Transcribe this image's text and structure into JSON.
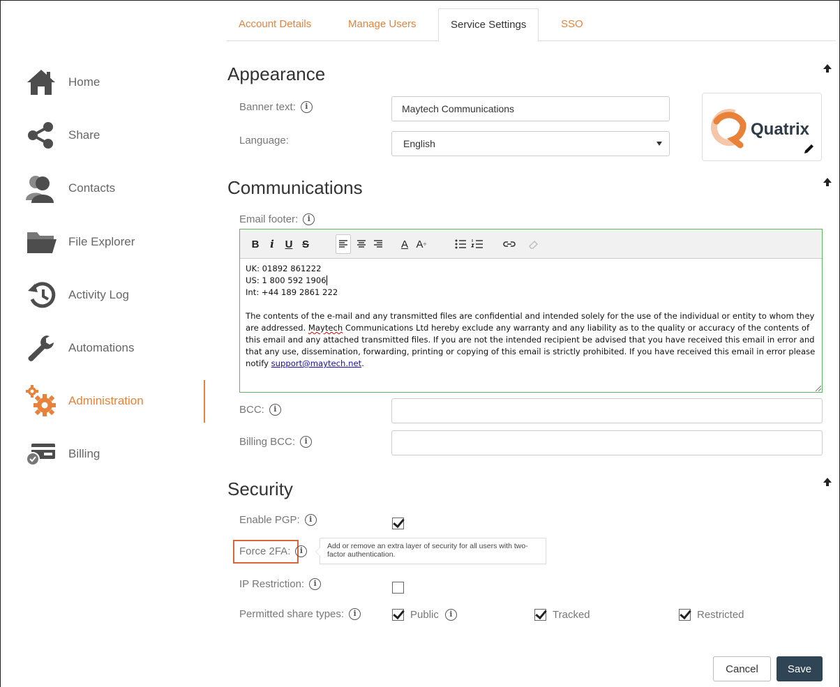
{
  "tabs": [
    {
      "label": "Account Details"
    },
    {
      "label": "Manage Users"
    },
    {
      "label": "Service Settings",
      "active": true
    },
    {
      "label": "SSO"
    }
  ],
  "sidebar": {
    "items": [
      {
        "label": "Home",
        "icon": "home-icon"
      },
      {
        "label": "Share",
        "icon": "share-icon"
      },
      {
        "label": "Contacts",
        "icon": "contacts-icon"
      },
      {
        "label": "File Explorer",
        "icon": "folder-icon"
      },
      {
        "label": "Activity Log",
        "icon": "history-icon"
      },
      {
        "label": "Automations",
        "icon": "wrench-icon"
      },
      {
        "label": "Administration",
        "icon": "gears-icon",
        "active": true
      },
      {
        "label": "Billing",
        "icon": "billing-icon"
      }
    ]
  },
  "appearance": {
    "title": "Appearance",
    "banner_label": "Banner text:",
    "banner_value": "Maytech Communications",
    "language_label": "Language:",
    "language_value": "English",
    "logo_text": "Quatrix"
  },
  "communications": {
    "title": "Communications",
    "email_footer_label": "Email footer:",
    "footer_lines": [
      "UK: 01892 861222",
      "US: 1 800 592 1906",
      "Int:  +44 189 2861 222"
    ],
    "footer_para_before": "The contents of the e-mail and any transmitted files are confidential and intended solely for the use of the individual or entity to whom they are addressed. ",
    "footer_company": "Maytech",
    "footer_para_after": " Communications Ltd hereby exclude any warranty and any liability as to the quality or accuracy of the contents of this email and any attached transmitted files. If you are not the intended recipient be advised that you have received this email in error and that any use, dissemination, forwarding, printing or copying of this email is strictly prohibited. If you have received this email in error please notify ",
    "footer_email": "support@maytech.net",
    "footer_end": ".",
    "bcc_label": "BCC:",
    "bcc_value": "",
    "billing_bcc_label": "Billing BCC:",
    "billing_bcc_value": ""
  },
  "security": {
    "title": "Security",
    "pgp_label": "Enable PGP:",
    "pgp_checked": true,
    "force2fa_label": "Force 2FA:",
    "tooltip": "Add or remove an extra layer of security for all users with two-factor authentication.",
    "ip_label": "IP Restriction:",
    "ip_checked": false,
    "share_types_label": "Permitted share types:",
    "share_types": [
      {
        "label": "Public",
        "checked": true
      },
      {
        "label": "Tracked",
        "checked": true
      },
      {
        "label": "Restricted",
        "checked": true
      }
    ]
  },
  "buttons": {
    "cancel": "Cancel",
    "save": "Save"
  },
  "colors": {
    "accent": "#e8823b",
    "save_bg": "#2f4454",
    "editor_border": "#5cb85c",
    "highlight_box": "#d9673c"
  }
}
